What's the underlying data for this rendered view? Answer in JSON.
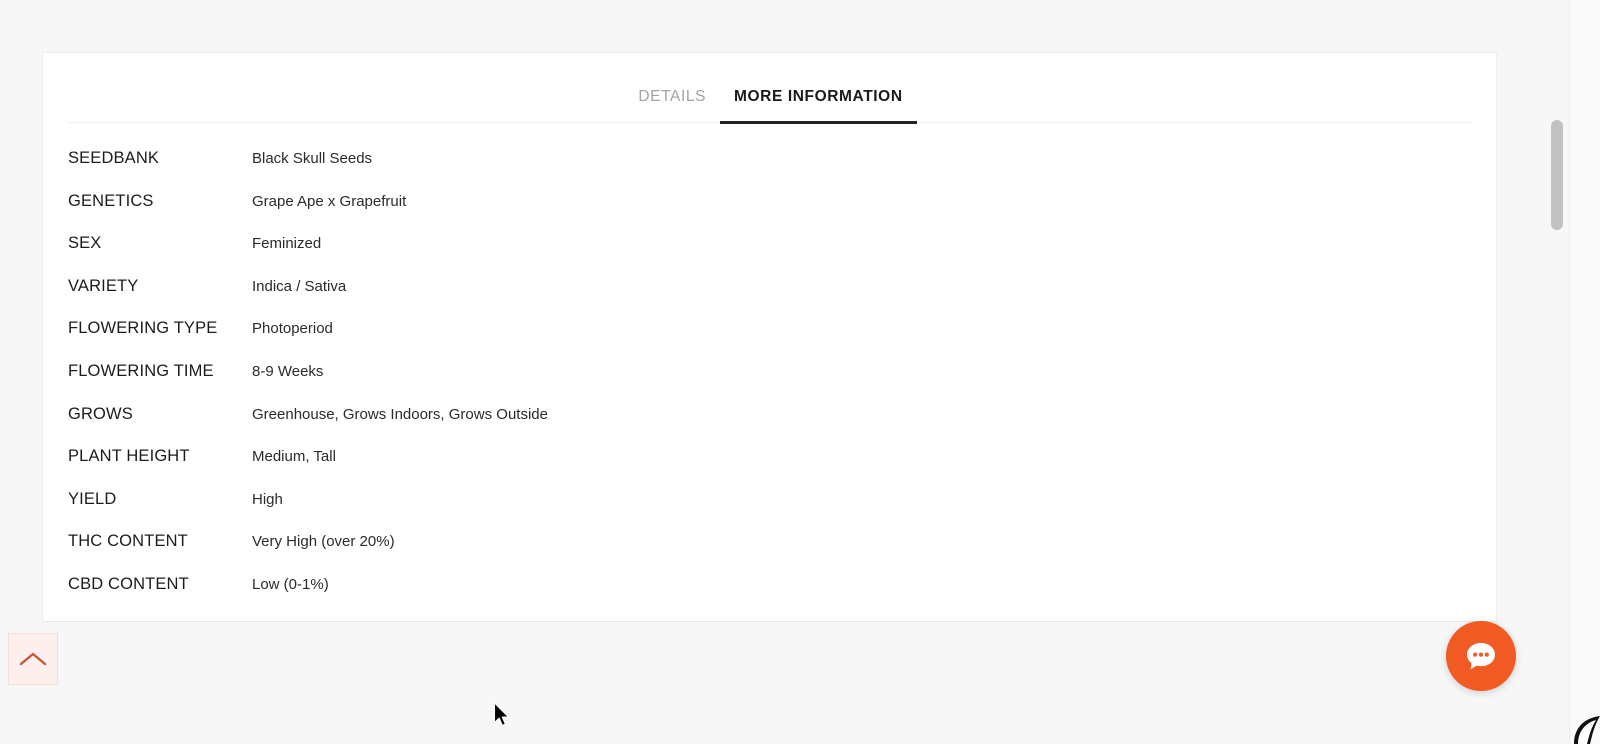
{
  "page": {
    "background_color": "#f7f7f7",
    "card_background_color": "#ffffff"
  },
  "tabs": [
    {
      "label": "DETAILS",
      "active": false,
      "name": "tab-details"
    },
    {
      "label": "MORE INFORMATION",
      "active": true,
      "name": "tab-more-information"
    }
  ],
  "more_information": {
    "rows": [
      {
        "label": "SEEDBANK",
        "value": "Black Skull Seeds"
      },
      {
        "label": "GENETICS",
        "value": "Grape Ape x Grapefruit"
      },
      {
        "label": "SEX",
        "value": "Feminized"
      },
      {
        "label": "VARIETY",
        "value": "Indica / Sativa"
      },
      {
        "label": "FLOWERING TYPE",
        "value": "Photoperiod"
      },
      {
        "label": "FLOWERING TIME",
        "value": "8-9 Weeks"
      },
      {
        "label": "GROWS",
        "value": "Greenhouse, Grows Indoors, Grows Outside"
      },
      {
        "label": "PLANT HEIGHT",
        "value": "Medium, Tall"
      },
      {
        "label": "YIELD",
        "value": "High"
      },
      {
        "label": "THC CONTENT",
        "value": "Very High (over 20%)"
      },
      {
        "label": "CBD CONTENT",
        "value": "Low (0-1%)"
      }
    ]
  },
  "back_to_top": {
    "icon": "chevron-up-icon",
    "icon_color": "#c4593a",
    "background_color": "#fdf0ec"
  },
  "chat_widget": {
    "icon": "chat-bubble-icon",
    "background_color": "#f15a22",
    "bubble_color": "#ffffff",
    "dot_color": "#f15a22"
  },
  "scrollbar": {
    "track_color": "#fafafa",
    "thumb_color": "#c2c2c2"
  },
  "accent_colors": {
    "orange": "#f15a22",
    "tab_active_underline": "#222222",
    "tab_inactive_text": "#a3a3a3"
  }
}
